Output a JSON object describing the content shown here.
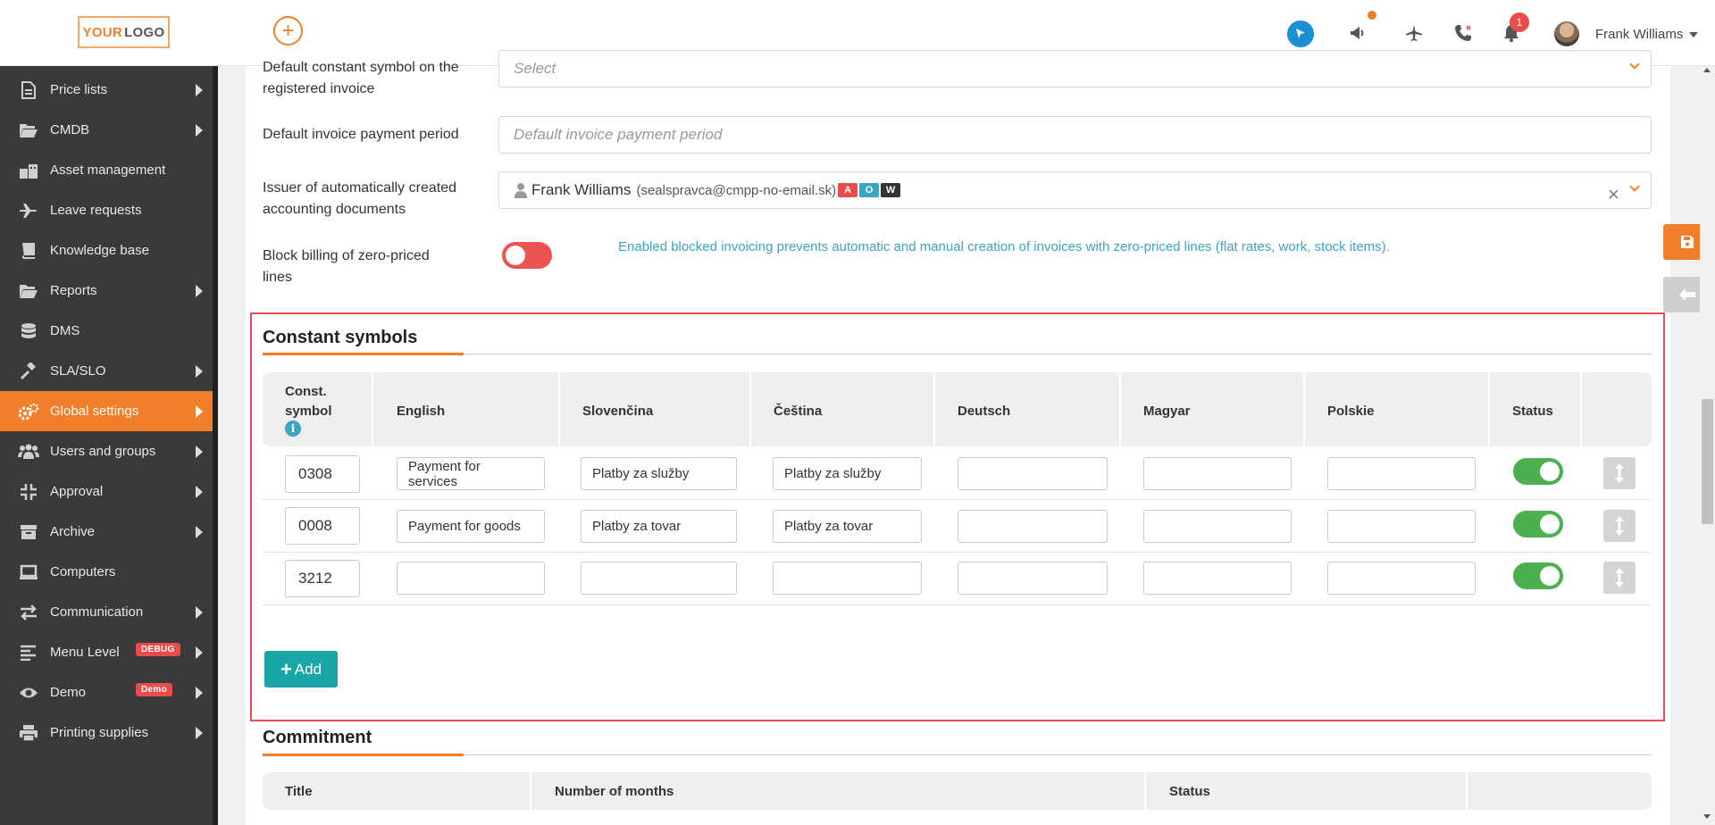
{
  "header": {
    "logo_your": "YOUR",
    "logo_logo": "LOGO",
    "notification_count": "1",
    "user_name": "Frank Williams"
  },
  "sidebar": {
    "items": [
      {
        "label": "Price lists",
        "icon": "document-icon"
      },
      {
        "label": "CMDB",
        "icon": "folder-open-icon"
      },
      {
        "label": "Asset management",
        "icon": "asset-icon"
      },
      {
        "label": "Leave requests",
        "icon": "plane-icon"
      },
      {
        "label": "Knowledge base",
        "icon": "book-icon"
      },
      {
        "label": "Reports",
        "icon": "folder-open-icon"
      },
      {
        "label": "DMS",
        "icon": "database-icon"
      },
      {
        "label": "SLA/SLO",
        "icon": "gavel-icon"
      },
      {
        "label": "Global settings",
        "icon": "cogs-icon"
      },
      {
        "label": "Users and groups",
        "icon": "users-icon"
      },
      {
        "label": "Approval",
        "icon": "compress-icon"
      },
      {
        "label": "Archive",
        "icon": "archive-icon"
      },
      {
        "label": "Computers",
        "icon": "laptop-icon"
      },
      {
        "label": "Communication",
        "icon": "exchange-icon"
      },
      {
        "label": "Menu Level",
        "icon": "align-left-icon",
        "tag": "DEBUG"
      },
      {
        "label": "Demo",
        "icon": "eye-icon",
        "tag": "Demo"
      },
      {
        "label": "Printing supplies",
        "icon": "printer-icon"
      }
    ]
  },
  "form": {
    "constant_symbol_label": "Default constant symbol on the registered invoice",
    "constant_symbol_placeholder": "Select",
    "payment_period_label": "Default invoice payment period",
    "payment_period_placeholder": "Default invoice payment period",
    "issuer_label": "Issuer of automatically created accounting documents",
    "issuer_name": "Frank Williams",
    "issuer_email": "(sealspravca@cmpp-no-email.sk)",
    "issuer_badges": [
      "A",
      "O",
      "W"
    ],
    "block_billing_label": "Block billing of zero-priced lines",
    "block_billing_info": "Enabled blocked invoicing prevents automatic and manual creation of invoices with zero-priced lines (flat rates, work, stock items)."
  },
  "constant_symbols": {
    "title": "Constant symbols",
    "headers": {
      "code_line1": "Const.",
      "code_line2": "symbol",
      "info": "i",
      "english": "English",
      "slovencina": "Slovenčina",
      "cestina": "Čeština",
      "deutsch": "Deutsch",
      "magyar": "Magyar",
      "polskie": "Polskie",
      "status": "Status"
    },
    "rows": [
      {
        "code": "0308",
        "english": "Payment for services",
        "slovencina": "Platby za služby",
        "cestina": "Platby za služby",
        "deutsch": "",
        "magyar": "",
        "polskie": "",
        "status": "on"
      },
      {
        "code": "0008",
        "english": "Payment for goods",
        "slovencina": "Platby za tovar",
        "cestina": "Platby za tovar",
        "deutsch": "",
        "magyar": "",
        "polskie": "",
        "status": "on"
      },
      {
        "code": "3212",
        "english": "",
        "slovencina": "",
        "cestina": "",
        "deutsch": "",
        "magyar": "",
        "polskie": "",
        "status": "on"
      }
    ],
    "add_label": "Add"
  },
  "commitment": {
    "title": "Commitment",
    "headers": {
      "title": "Title",
      "months": "Number of months",
      "status": "Status"
    }
  },
  "colors": {
    "accent": "#f07e2a",
    "teal": "#1aa6a6",
    "sidebar": "#3a3a3a",
    "toggle_on": "#4caf50",
    "toggle_off": "#ea5455",
    "highlight_border": "#e84c4c"
  }
}
